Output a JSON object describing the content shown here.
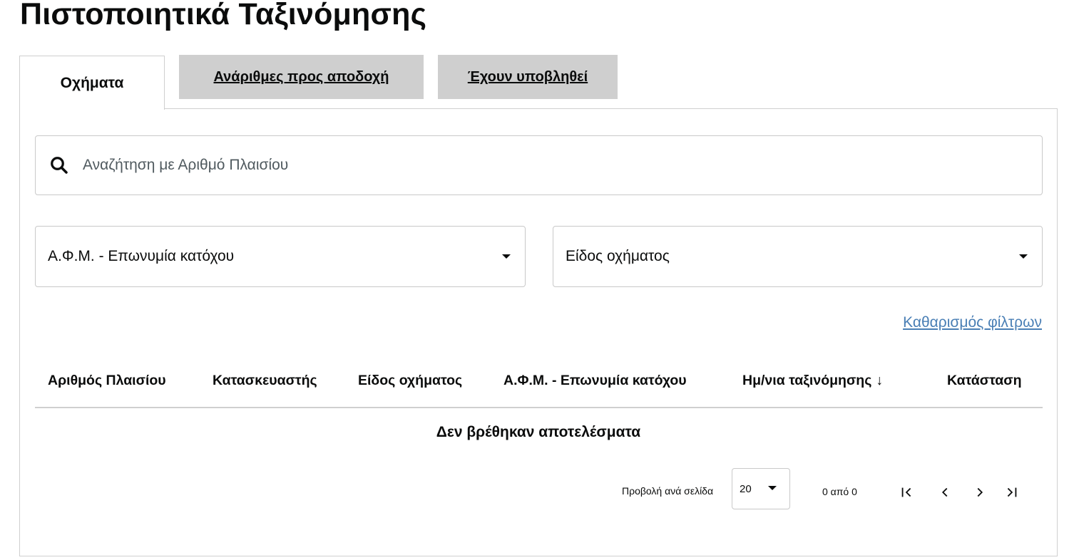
{
  "page": {
    "title": "Πιστοποιητικά Ταξινόμησης"
  },
  "tabs": [
    {
      "label": "Οχήματα",
      "active": true
    },
    {
      "label": "Ανάριθμες προς αποδοχή",
      "active": false
    },
    {
      "label": "Έχουν υποβληθεί",
      "active": false
    }
  ],
  "search": {
    "placeholder": "Αναζήτηση με Αριθμό Πλαισίου",
    "value": "",
    "icon": "search-icon"
  },
  "filters": {
    "owner": {
      "label": "Α.Φ.Μ. - Επωνυμία κατόχου"
    },
    "vehicle_type": {
      "label": "Είδος οχήματος"
    },
    "clear_label": "Καθαρισμός φίλτρων"
  },
  "table": {
    "columns": [
      "Αριθμός Πλαισίου",
      "Κατασκευαστής",
      "Είδος οχήματος",
      "Α.Φ.Μ. - Επωνυμία κατόχου",
      "Ημ/νια ταξινόμησης",
      "Κατάσταση"
    ],
    "sort_indicator": "↓",
    "empty_message": "Δεν βρέθηκαν αποτελέσματα"
  },
  "pagination": {
    "per_page_label": "Προβολή ανά σελίδα",
    "per_page_value": "20",
    "range_text": "0 από 0"
  },
  "colors": {
    "tab_inactive_bg": "#cfcfcf",
    "link": "#4a7fb5",
    "border": "#c9c9c9"
  }
}
